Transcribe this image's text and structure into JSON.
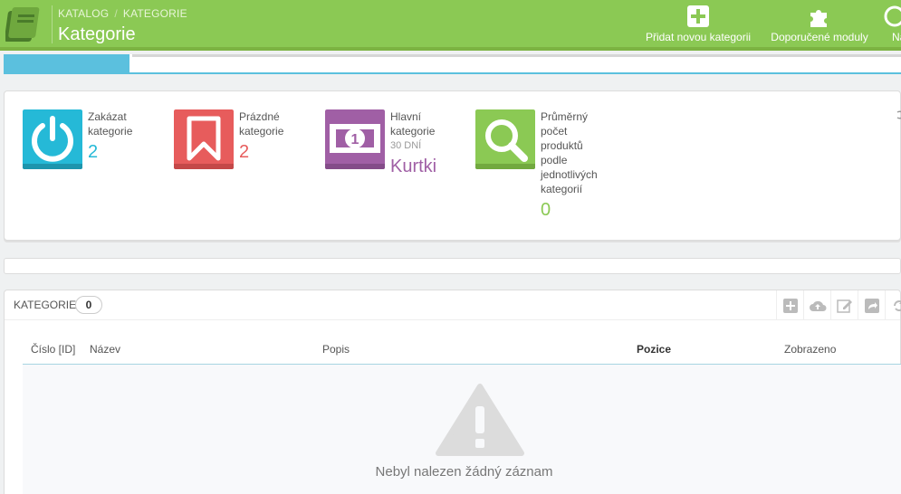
{
  "header": {
    "breadcrumb": [
      "KATALOG",
      "KATEGORIE"
    ],
    "breadcrumb_separator": "/",
    "title": "Kategorie",
    "logo_icon": "book-icon",
    "toolbar": [
      {
        "label": "Přidat novou kategorii",
        "icon": "add-icon"
      },
      {
        "label": "Doporučené moduly",
        "icon": "puzzle-icon"
      },
      {
        "label": "Náp",
        "icon": "help-icon"
      }
    ],
    "bg_color": "#8bc954"
  },
  "progress": {
    "accent_color": "#5bc0de",
    "fill_fraction": 0.14
  },
  "kpis": [
    {
      "label": "Zakázat kategorie",
      "value": "2",
      "icon": "power-icon",
      "color": "#25b9d7"
    },
    {
      "label": "Prázdné kategorie",
      "value": "2",
      "icon": "bookmark-icon",
      "color": "#e75c5c"
    },
    {
      "label": "Hlavní kategorie",
      "sub": "30 DNÍ",
      "value": "Kurtki",
      "icon": "money-icon",
      "color": "#a05fa5"
    },
    {
      "label": "Průměrný počet produktů podle jednotlivých kategorií",
      "value": "0",
      "icon": "search-icon",
      "color": "#8bc954"
    }
  ],
  "list": {
    "title": "KATEGORIE",
    "count": "0",
    "actions": [
      "add-icon",
      "cloud-upload-icon",
      "edit-icon",
      "export-icon",
      "refresh-icon"
    ],
    "columns": [
      "Číslo [ID]",
      "Název",
      "Popis",
      "Pozice",
      "Zobrazeno"
    ],
    "empty_message": "Nebyl nalezen žádný záznam",
    "empty_icon": "warning-icon"
  }
}
